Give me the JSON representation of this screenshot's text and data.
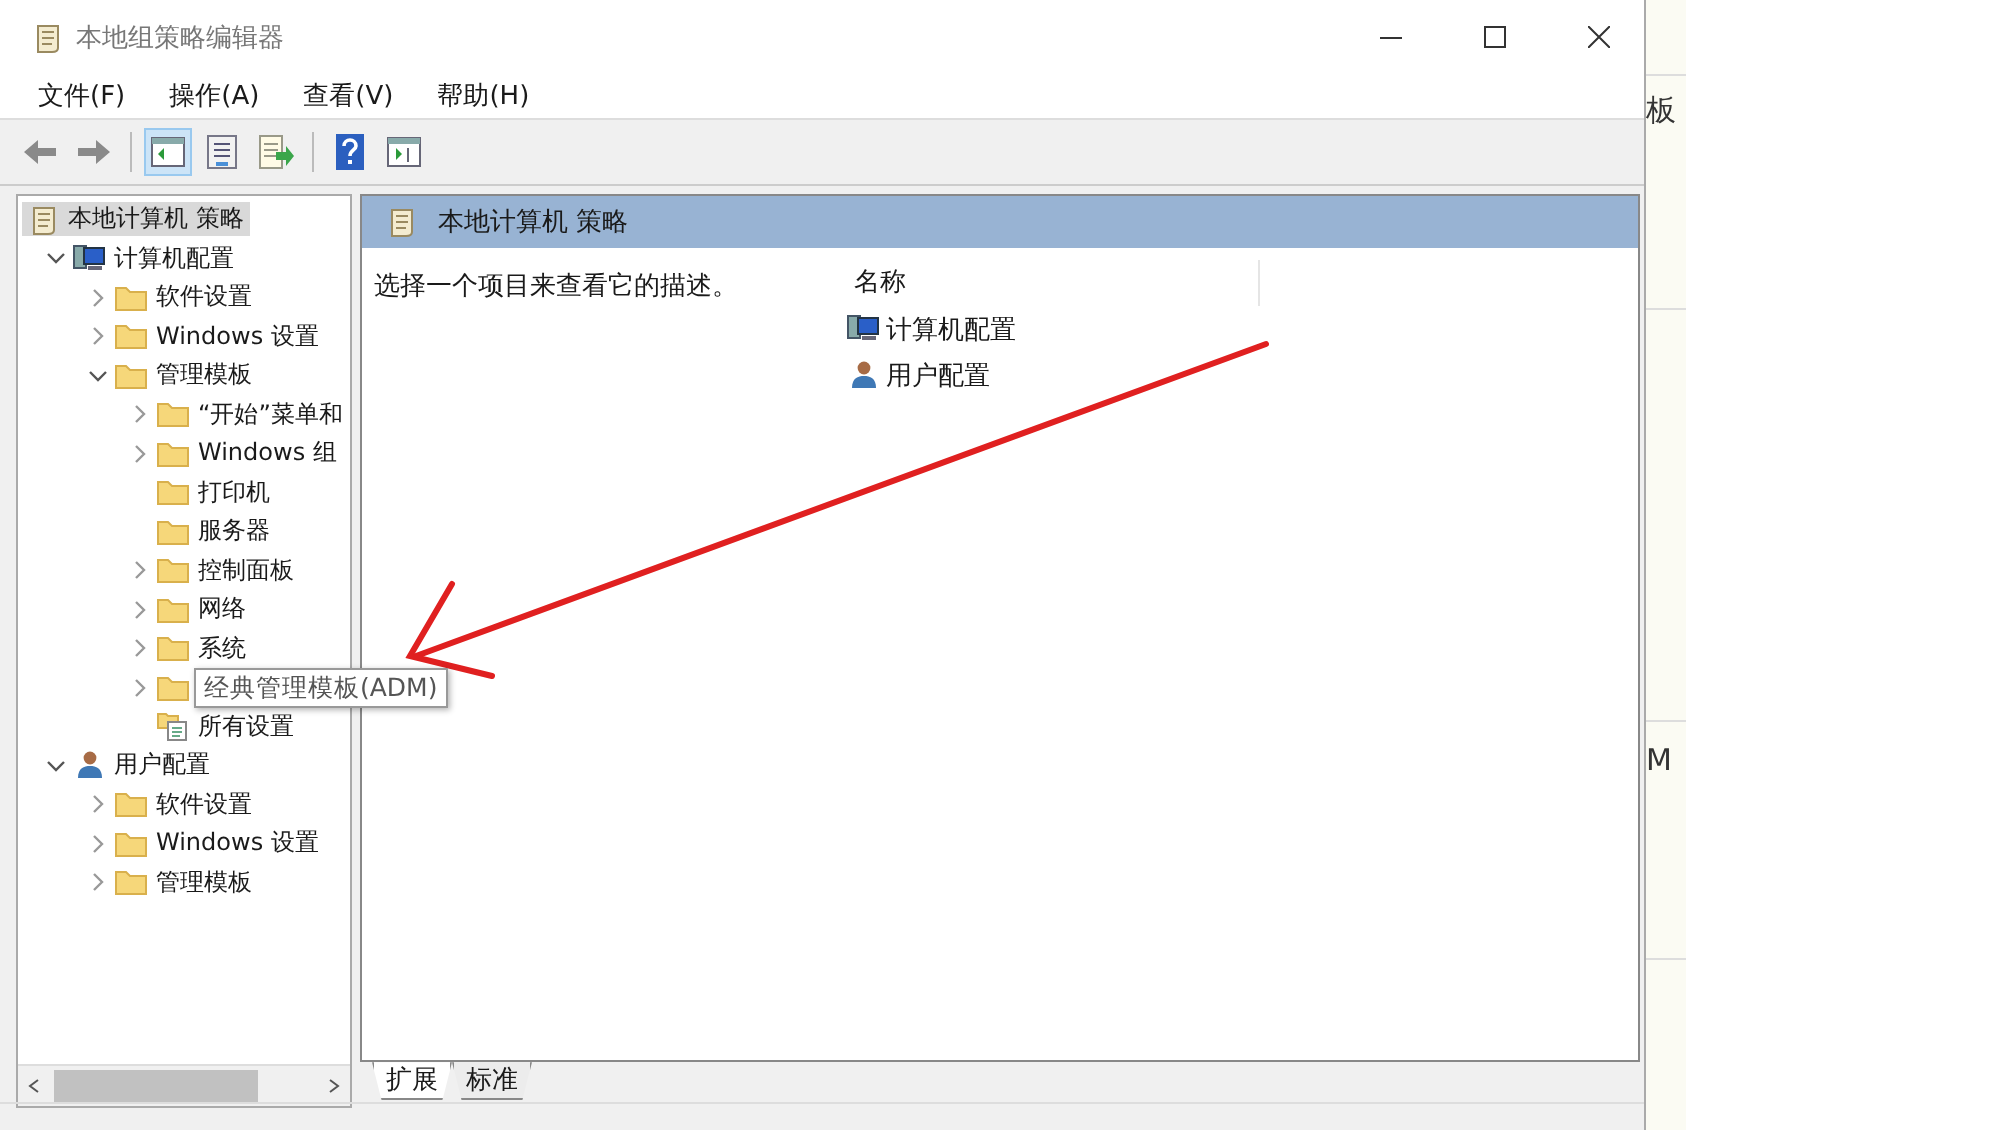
{
  "window": {
    "title": "本地组策略编辑器"
  },
  "menu": [
    {
      "label": "文件(F)"
    },
    {
      "label": "操作(A)"
    },
    {
      "label": "查看(V)"
    },
    {
      "label": "帮助(H)"
    }
  ],
  "toolbar": [
    [
      {
        "kind": "back",
        "selected": false
      },
      {
        "kind": "forward",
        "selected": false
      }
    ],
    [
      {
        "kind": "tree-pane",
        "selected": true
      },
      {
        "kind": "properties",
        "selected": false
      },
      {
        "kind": "export",
        "selected": false
      }
    ],
    [
      {
        "kind": "help",
        "selected": false
      },
      {
        "kind": "action-pane",
        "selected": false
      }
    ]
  ],
  "tree": {
    "label": "本地计算机 策略",
    "kind": "policy",
    "selected": true,
    "children": [
      {
        "label": "计算机配置",
        "kind": "computer",
        "expanded": true,
        "selected": false,
        "children": [
          {
            "label": "软件设置",
            "kind": "folder",
            "expanded": false,
            "selected": false
          },
          {
            "label": "Windows 设置",
            "kind": "folder",
            "expanded": false,
            "selected": false
          },
          {
            "label": "管理模板",
            "kind": "folder",
            "expanded": true,
            "selected": false,
            "children": [
              {
                "label": "“开始”菜单和",
                "kind": "folder",
                "expanded": false,
                "selected": false
              },
              {
                "label": "Windows 组",
                "kind": "folder",
                "expanded": false,
                "selected": false
              },
              {
                "label": "打印机",
                "kind": "folder",
                "selected": false
              },
              {
                "label": "服务器",
                "kind": "folder",
                "selected": false
              },
              {
                "label": "控制面板",
                "kind": "folder",
                "expanded": false,
                "selected": false
              },
              {
                "label": "网络",
                "kind": "folder",
                "expanded": false,
                "selected": false
              },
              {
                "label": "系统",
                "kind": "folder",
                "expanded": false,
                "selected": false
              },
              {
                "tooltip": "经典管理模板(ADM)",
                "kind": "folder",
                "expanded": false,
                "selected": false
              },
              {
                "label": "所有设置",
                "kind": "settings",
                "selected": false
              }
            ]
          }
        ]
      },
      {
        "label": "用户配置",
        "kind": "user",
        "expanded": true,
        "selected": false,
        "children": [
          {
            "label": "软件设置",
            "kind": "folder",
            "expanded": false,
            "selected": false
          },
          {
            "label": "Windows 设置",
            "kind": "folder",
            "expanded": false,
            "selected": false
          },
          {
            "label": "管理模板",
            "kind": "folder",
            "expanded": false,
            "selected": false
          }
        ]
      }
    ]
  },
  "details": {
    "title": "本地计算机 策略",
    "description": "选择一个项目来查看它的描述。",
    "column": "名称",
    "items": [
      {
        "label": "计算机配置",
        "kind": "computer"
      },
      {
        "label": "用户配置",
        "kind": "user"
      }
    ]
  },
  "tabs": [
    {
      "label": "扩展",
      "selected": true
    },
    {
      "label": "标准",
      "selected": false
    }
  ],
  "background": {
    "fragments": [
      "板",
      "M"
    ]
  }
}
